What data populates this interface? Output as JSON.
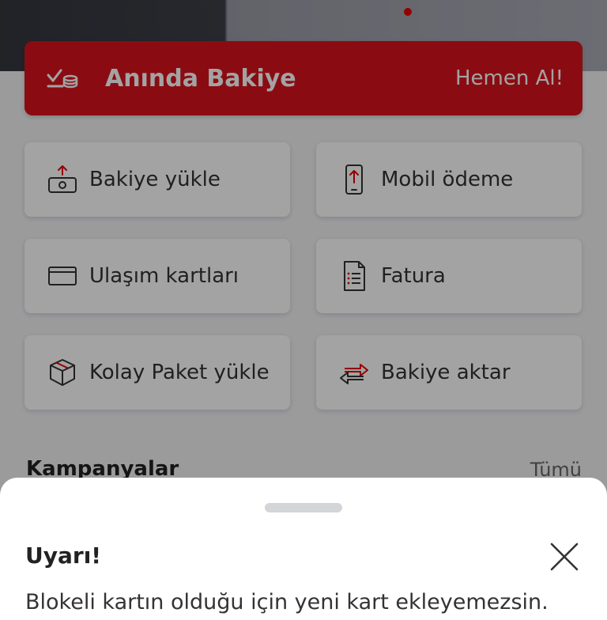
{
  "banner": {
    "title": "Anında Bakiye",
    "action": "Hemen Al!",
    "icon": "check-coins-icon"
  },
  "tiles": [
    {
      "label": "Bakiye yükle",
      "icon": "money-upload-icon"
    },
    {
      "label": "Mobil ödeme",
      "icon": "phone-payment-icon"
    },
    {
      "label": "Ulaşım kartları",
      "icon": "card-icon"
    },
    {
      "label": "Fatura",
      "icon": "invoice-icon"
    },
    {
      "label": "Kolay Paket yükle",
      "icon": "package-icon"
    },
    {
      "label": "Bakiye aktar",
      "icon": "transfer-arrows-icon"
    }
  ],
  "campaigns": {
    "title": "Kampanyalar",
    "all_link": "Tümü"
  },
  "sheet": {
    "title": "Uyarı!",
    "message": "Blokeli kartın olduğu için yeni kart ekleyemezsin.",
    "close_icon": "close-icon"
  },
  "colors": {
    "brand_red": "#e60000",
    "overlay": "rgba(0,0,0,0.36)"
  }
}
